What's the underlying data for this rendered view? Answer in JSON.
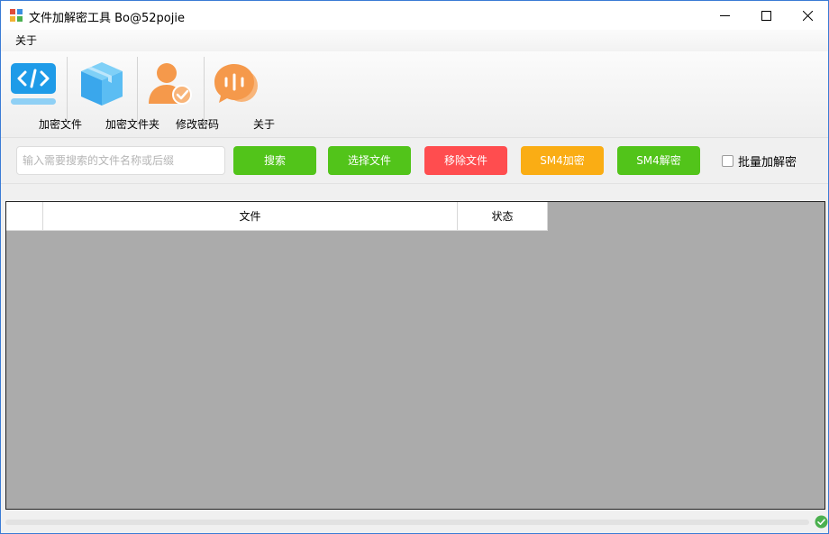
{
  "window": {
    "title": "文件加解密工具 Bo@52pojie"
  },
  "menu": {
    "about": "关于"
  },
  "toolbar": {
    "items": [
      {
        "label": "加密文件",
        "icon": "code-icon"
      },
      {
        "label": "加密文件夹",
        "icon": "box-icon"
      },
      {
        "label": "修改密码",
        "icon": "user-check-icon"
      },
      {
        "label": "关于",
        "icon": "chat-bubble-icon"
      }
    ]
  },
  "search": {
    "placeholder": "输入需要搜索的文件名称或后缀",
    "value": ""
  },
  "buttons": {
    "search": "搜索",
    "select_file": "选择文件",
    "remove_file": "移除文件",
    "sm4_encrypt": "SM4加密",
    "sm4_decrypt": "SM4解密"
  },
  "batch": {
    "label": "批量加解密",
    "checked": false
  },
  "grid": {
    "columns": [
      "",
      "文件",
      "状态"
    ],
    "rows": []
  },
  "status": {
    "progress": 0
  },
  "colors": {
    "green": "#52c41a",
    "red": "#ff4d4f",
    "orange": "#faad14",
    "blue": "#1e9be8",
    "user_orange": "#f5994b"
  }
}
